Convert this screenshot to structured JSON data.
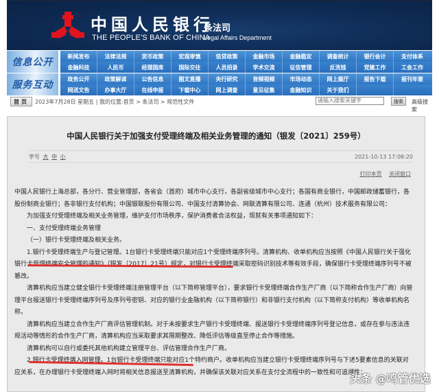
{
  "header": {
    "cn_title": "中国人民银行",
    "en_title": "THE PEOPLE'S BANK OF CHINA",
    "dept_cn": "条法司",
    "dept_en": "Legal Affairs Department",
    "logo_icon": "pboc-logo-icon"
  },
  "nav": {
    "groups": [
      {
        "label": "信息公开",
        "rows": [
          [
            "新闻发布",
            "法律法规",
            "货币政策",
            "宏观审慎",
            "信贷政策",
            "金融市场",
            "金融稳定",
            "调查统计",
            "银行会计",
            "支付体系"
          ],
          [
            "金融科技",
            "人民币",
            "经理国库",
            "国际交往",
            "人员招录",
            "学术交流",
            "征信管理",
            "反洗钱",
            "党建工作",
            "工会工作"
          ]
        ]
      },
      {
        "label": "服务互动",
        "rows": [
          [
            "政务公开",
            "政策解读",
            "公告信息",
            "图文直播",
            "央行研究",
            "音频视频",
            "市场动态",
            "网上展厅",
            "报告下载",
            "报刊年鉴"
          ],
          [
            "网送文告",
            "办事大厅",
            "在线申报",
            "下载中心",
            "网上调查",
            "意见征集",
            "金融知识",
            "关于我们",
            "",
            ""
          ]
        ]
      }
    ]
  },
  "infobar": {
    "home_label": "首页",
    "date": "2023年7月28日 星期五",
    "location_label": "我的位置:",
    "breadcrumb": [
      "首页",
      "条法司",
      "规范性文件"
    ],
    "search_placeholder": "请输入搜索关键字",
    "search_button": "搜索",
    "advanced_search": "高级搜索"
  },
  "article": {
    "title": "中国人民银行关于加强支付受理终端及相关业务管理的通知（银发〔2021〕259号）",
    "font_size_label": "字号",
    "font_sizes": [
      "大",
      "中",
      "小"
    ],
    "datetime": "2021-10-13 17:08:20",
    "print_label": "打印本页",
    "close_label": "关闭窗口",
    "paragraphs": [
      "中国人民银行上海总部，各分行、营业管理部，各省会（首府）城市中心支行，各副省级城市中心支行；各国有商业银行，中国邮政储蓄银行，各股份制商业银行；各非银行支付机构；中国银联股份有限公司、中国支付清算协会、网联清算有限公司、连通（杭州）技术服务有限公司：",
      "为加强支付受理终端及相关业务管理，维护支付市场秩序，保护消费者合法权益，现就有关事项通知如下：",
      "一、支付受理终端业务管理",
      "（一）银行卡受理终端及相关业务。",
      "1.银行卡受理终端生产与登记管理。1台银行卡受理终端只能对应1个受理终端序列号。清算机构、收单机构应当按照《中国人民银行关于强化银行卡受理终端安全管理的通知》（银发〔2017〕21号）规定，对银行卡受理终端采取密码识别技术等有效手段，确保银行卡受理终端序列号不被篡改。",
      "清算机构应当建立健全银行卡受理终端注册管理平台（以下简称管理平台），要求银行卡受理终端合作生产厂商（以下简称合作生产厂商）向管理平台报送银行卡受理终端序列号及序列号密钥、对应的银行业金融机构（以下简称银行）和非银行支付机构（以下简称支付机构）等收单机构名称。",
      "清算机构应当建立合作生产厂商评估管理机制。对于未按要求生产银行卡受理终端、报送银行卡受理终端序列号登记信息，或存在参与违法违规活动等情形的合作生产厂商，清算机构应当采取要求其限期整改、降低评估等级直至停止合作等措施。",
      "清算机构可以自行或委托其他机构建立管理平台、评估管理合作生产厂商。",
      "2.银行卡受理终端入网管理。1台银行卡受理终端只能对应1个特约商户。收单机构应当建立银行卡受理终端序列号与下述5要素信息的关联对应关系，在办理银行卡受理终端入网时将相关信息报送至清算机构，并确保该关联对应关系在支付全流程中的一致性和可追溯性："
    ]
  },
  "watermark": "头条 @鸣管优选",
  "colors": {
    "banner": "#0f2d57",
    "nav_blue": "#2f78c6",
    "highlight_red": "#e03030",
    "content_bg": "#eaeaea"
  }
}
